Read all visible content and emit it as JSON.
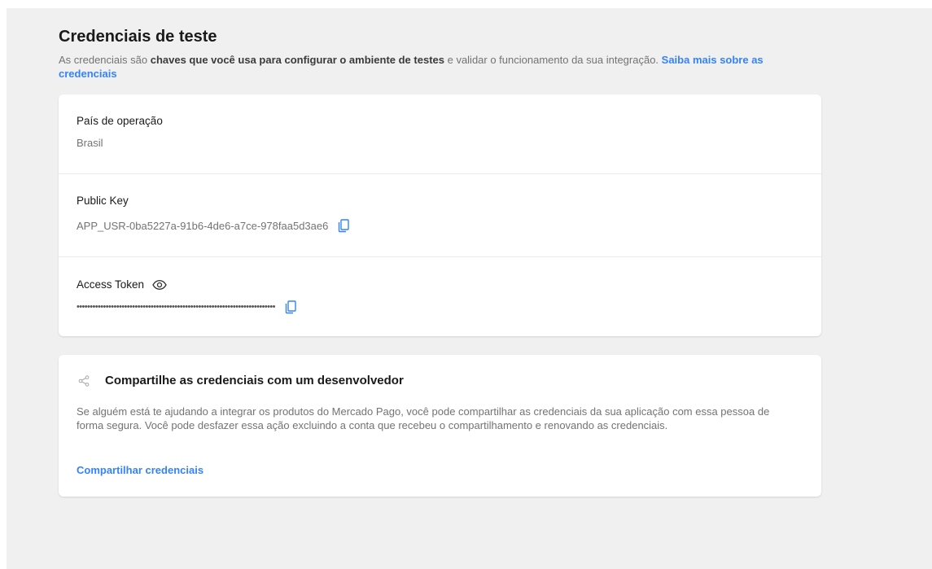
{
  "header": {
    "title": "Credenciais de teste",
    "description_part1": "As credenciais são ",
    "description_bold": "chaves que você usa para configurar o ambiente de testes",
    "description_part2": " e validar o funcionamento da sua integração. ",
    "description_link": "Saiba mais sobre as credenciais"
  },
  "credentials": {
    "country_label": "País de operação",
    "country_value": "Brasil",
    "public_key_label": "Public Key",
    "public_key_value": "APP_USR-0ba5227a-91b6-4de6-a7ce-978faa5d3ae6",
    "access_token_label": "Access Token",
    "access_token_value": "•••••••••••••••••••••••••••••••••••••••••••••••••••••••••••••••••••••••••••"
  },
  "share": {
    "title": "Compartilhe as credenciais com um desenvolvedor",
    "text": "Se alguém está te ajudando a integrar os produtos do Mercado Pago, você pode compartilhar as credenciais da sua aplicação com essa pessoa de forma segura. Você pode desfazer essa ação excluindo a conta que recebeu o compartilhamento e renovando as credenciais.",
    "link": "Compartilhar credenciais"
  },
  "icons": {
    "copy": "copy-icon",
    "eye": "eye-icon",
    "share": "share-icon"
  },
  "colors": {
    "accent": "#3483fa",
    "background": "#f0f0f0",
    "card": "#ffffff"
  }
}
